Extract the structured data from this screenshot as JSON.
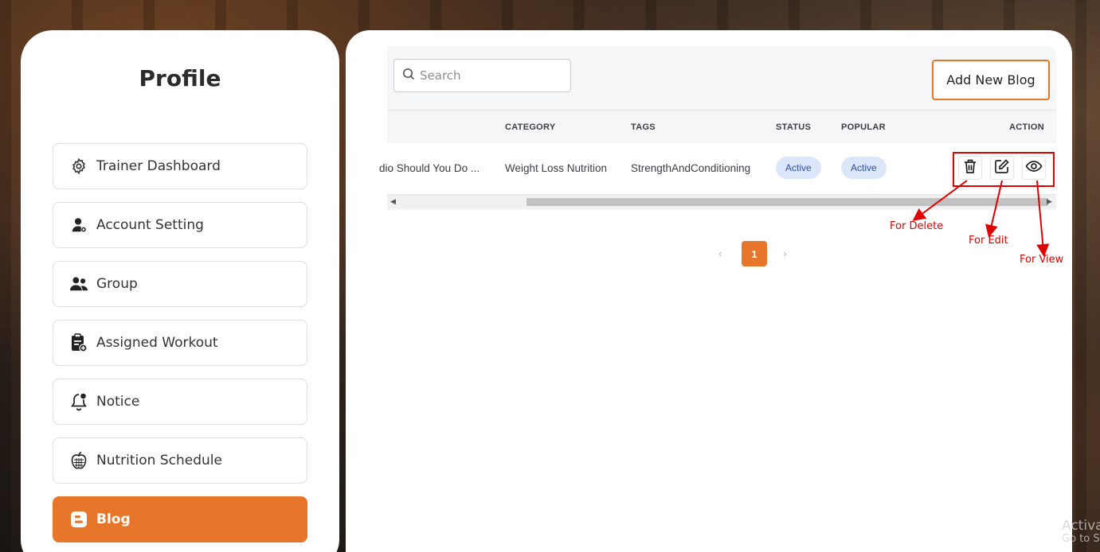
{
  "sidebar": {
    "title": "Profile",
    "items": [
      {
        "label": "Trainer Dashboard",
        "icon": "gear-icon"
      },
      {
        "label": "Account Setting",
        "icon": "user-settings-icon"
      },
      {
        "label": "Group",
        "icon": "users-icon"
      },
      {
        "label": "Assigned Workout",
        "icon": "clipboard-icon"
      },
      {
        "label": "Notice",
        "icon": "bell-icon"
      },
      {
        "label": "Nutrition Schedule",
        "icon": "apple-icon"
      },
      {
        "label": "Blog",
        "icon": "blogger-icon",
        "active": true
      }
    ]
  },
  "toolbar": {
    "search_placeholder": "Search",
    "add_button_label": "Add New Blog"
  },
  "table": {
    "columns": [
      "CATEGORY",
      "TAGS",
      "STATUS",
      "POPULAR",
      "ACTION"
    ],
    "rows": [
      {
        "title": "dio Should You Do ...",
        "category": "Weight Loss Nutrition",
        "tags": "StrengthAndConditioning",
        "status": "Active",
        "popular": "Active"
      }
    ]
  },
  "pagination": {
    "current_page": "1",
    "prev_symbol": "‹",
    "next_symbol": "›"
  },
  "annotations": {
    "delete": "For Delete",
    "edit": "For Edit",
    "view": "For View"
  },
  "watermark": {
    "line1": "Activate Windows",
    "line2": "Go to Settings to activate Windows."
  },
  "colors": {
    "accent": "#e8762a",
    "annotation_red": "#e00000",
    "badge_bg": "#dbe6fb",
    "badge_text": "#2b4fa3"
  }
}
